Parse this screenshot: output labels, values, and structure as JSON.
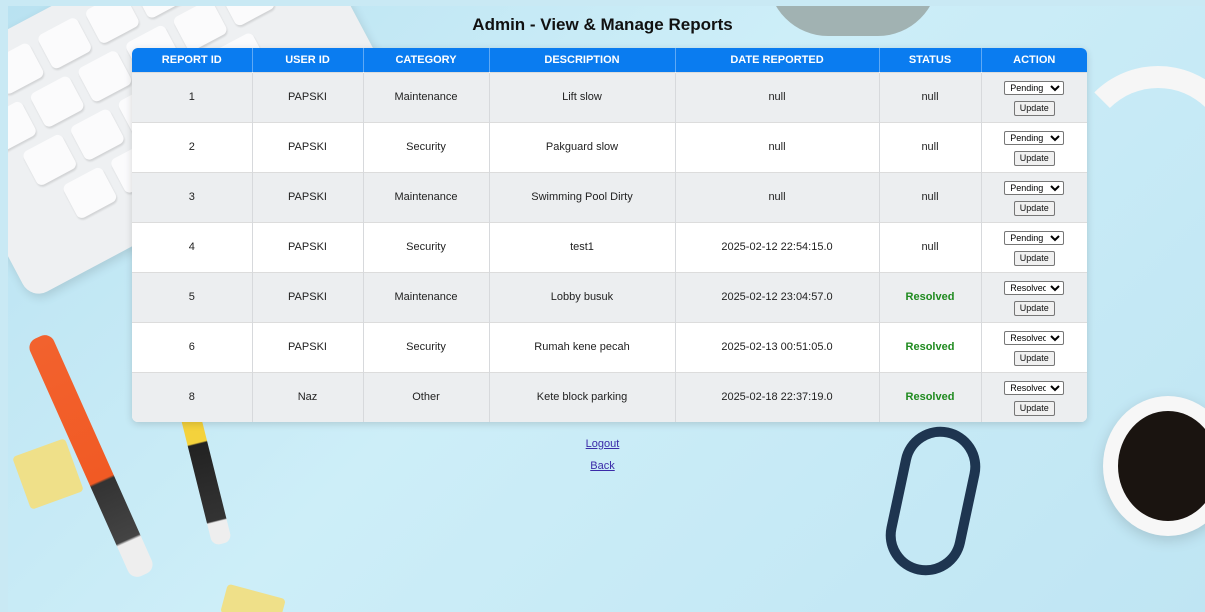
{
  "page": {
    "title": "Admin - View & Manage Reports"
  },
  "table": {
    "headers": [
      "REPORT ID",
      "USER ID",
      "CATEGORY",
      "DESCRIPTION",
      "DATE REPORTED",
      "STATUS",
      "ACTION"
    ],
    "rows": [
      {
        "report_id": "1",
        "user_id": "PAPSKI",
        "category": "Maintenance",
        "description": "Lift slow",
        "date_reported": "null",
        "status": "null",
        "status_select": "Pending",
        "update_label": "Update"
      },
      {
        "report_id": "2",
        "user_id": "PAPSKI",
        "category": "Security",
        "description": "Pakguard slow",
        "date_reported": "null",
        "status": "null",
        "status_select": "Pending",
        "update_label": "Update"
      },
      {
        "report_id": "3",
        "user_id": "PAPSKI",
        "category": "Maintenance",
        "description": "Swimming Pool Dirty",
        "date_reported": "null",
        "status": "null",
        "status_select": "Pending",
        "update_label": "Update"
      },
      {
        "report_id": "4",
        "user_id": "PAPSKI",
        "category": "Security",
        "description": "test1",
        "date_reported": "2025-02-12 22:54:15.0",
        "status": "null",
        "status_select": "Pending",
        "update_label": "Update"
      },
      {
        "report_id": "5",
        "user_id": "PAPSKI",
        "category": "Maintenance",
        "description": "Lobby busuk",
        "date_reported": "2025-02-12 23:04:57.0",
        "status": "Resolved",
        "status_select": "Resolved",
        "update_label": "Update"
      },
      {
        "report_id": "6",
        "user_id": "PAPSKI",
        "category": "Security",
        "description": "Rumah kene pecah",
        "date_reported": "2025-02-13 00:51:05.0",
        "status": "Resolved",
        "status_select": "Resolved",
        "update_label": "Update"
      },
      {
        "report_id": "8",
        "user_id": "Naz",
        "category": "Other",
        "description": "Kete block parking",
        "date_reported": "2025-02-18 22:37:19.0",
        "status": "Resolved",
        "status_select": "Resolved",
        "update_label": "Update"
      }
    ]
  },
  "links": {
    "logout": "Logout",
    "back": "Back"
  },
  "colors": {
    "header_bg": "#0a7cf0",
    "resolved": "#1e8a1e",
    "link": "#3a2aa8"
  }
}
